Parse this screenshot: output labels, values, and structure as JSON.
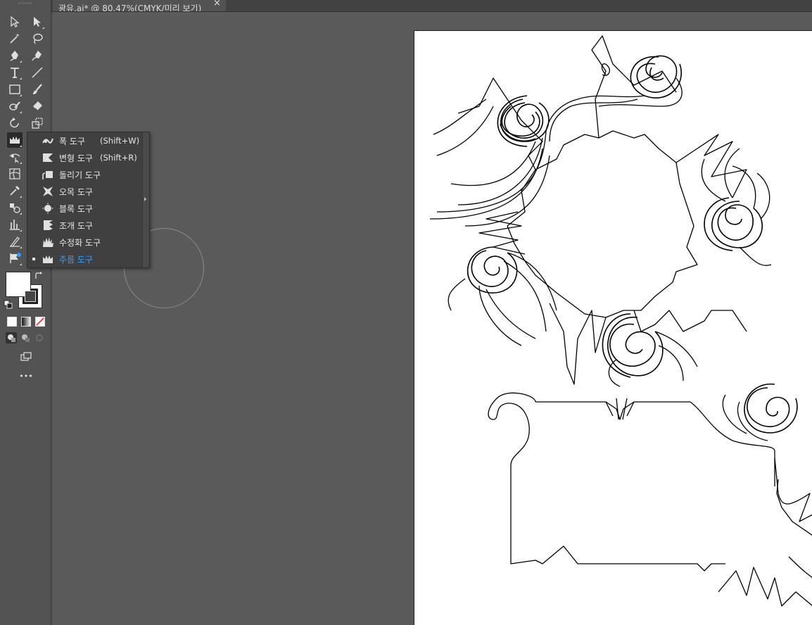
{
  "document_tab": {
    "title": "광유.ai* @ 80.47%(CMYK/미리 보기)",
    "close": "×"
  },
  "toolbar": {
    "more_label": "•••",
    "tools": [
      {
        "name": "selection-tool-icon"
      },
      {
        "name": "direct-selection-tool-icon"
      },
      {
        "name": "magic-wand-tool-icon"
      },
      {
        "name": "lasso-tool-icon"
      },
      {
        "name": "pen-tool-icon"
      },
      {
        "name": "curvature-tool-icon"
      },
      {
        "name": "type-tool-icon"
      },
      {
        "name": "line-tool-icon"
      },
      {
        "name": "rectangle-tool-icon"
      },
      {
        "name": "paintbrush-tool-icon"
      },
      {
        "name": "shaper-tool-icon"
      },
      {
        "name": "eraser-tool-icon"
      },
      {
        "name": "rotate-tool-icon"
      },
      {
        "name": "scale-tool-icon"
      },
      {
        "name": "crown-tool-icon"
      },
      {
        "name": "puppet-warp-tool-icon"
      },
      {
        "name": "free-transform-tool-icon"
      },
      {
        "name": "mesh-tool-icon"
      },
      {
        "name": "eyedropper-tool-icon"
      },
      {
        "name": "blend-tool-icon"
      },
      {
        "name": "graph-tool-icon"
      },
      {
        "name": "slice-tool-icon"
      },
      {
        "name": "artboard-tool-icon"
      }
    ]
  },
  "flyout": {
    "items": [
      {
        "label": "폭 도구",
        "shortcut": "(Shift+W)",
        "icon": "width-tool-icon"
      },
      {
        "label": "변형 도구",
        "shortcut": "(Shift+R)",
        "icon": "warp-tool-icon"
      },
      {
        "label": "돌리기 도구",
        "shortcut": "",
        "icon": "twirl-tool-icon"
      },
      {
        "label": "오목 도구",
        "shortcut": "",
        "icon": "pucker-tool-icon"
      },
      {
        "label": "블록 도구",
        "shortcut": "",
        "icon": "bloat-tool-icon"
      },
      {
        "label": "조개 도구",
        "shortcut": "",
        "icon": "scallop-tool-icon"
      },
      {
        "label": "수정화 도구",
        "shortcut": "",
        "icon": "crystallize-tool-icon"
      },
      {
        "label": "주름 도구",
        "shortcut": "",
        "icon": "wrinkle-tool-icon",
        "selected": true
      }
    ]
  },
  "colors": {
    "fill": "#ffffff",
    "stroke": "#222222",
    "selected_text": "#3aa0ff"
  }
}
